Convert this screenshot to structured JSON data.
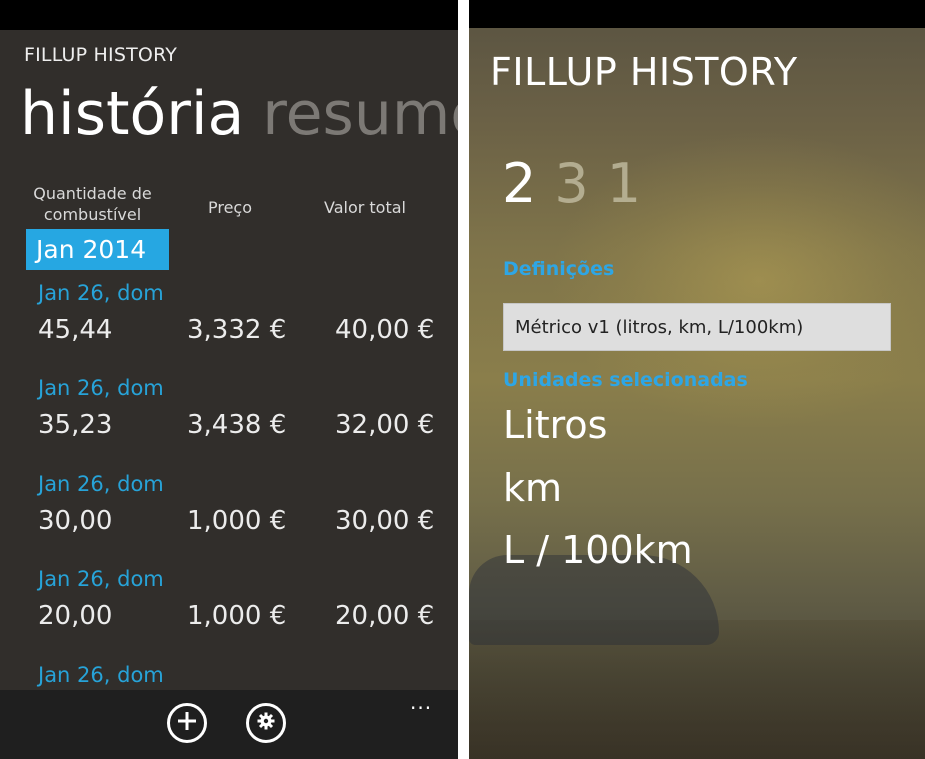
{
  "left": {
    "app_title": "FILLUP HISTORY",
    "pivot": {
      "active": "história",
      "inactive": "resumo"
    },
    "headers": {
      "quantity": "Quantidade de combustível",
      "price": "Preço",
      "total": "Valor total"
    },
    "month": "Jan 2014",
    "entries": [
      {
        "date": "Jan 26, dom",
        "quantity": "45,44",
        "price": "3,332 €",
        "total": "40,00 €"
      },
      {
        "date": "Jan 26, dom",
        "quantity": "35,23",
        "price": "3,438 €",
        "total": "32,00 €"
      },
      {
        "date": "Jan 26, dom",
        "quantity": "30,00",
        "price": "1,000 €",
        "total": "30,00 €"
      },
      {
        "date": "Jan 26, dom",
        "quantity": "20,00",
        "price": "1,000 €",
        "total": "20,00 €"
      },
      {
        "date": "Jan 26, dom"
      }
    ],
    "appbar": {
      "more": "...",
      "add_icon": "add-icon",
      "settings_icon": "gear-icon"
    }
  },
  "right": {
    "app_title": "FILLUP HISTORY",
    "pivot": {
      "active": "2",
      "inactive_1": "3",
      "inactive_2": "1"
    },
    "settings_label": "Definições",
    "units_setting": "Métrico v1 (litros, km, L/100km)",
    "selected_units_label": "Unidades selecionadas",
    "units": {
      "volume": "Litros",
      "distance": "km",
      "consumption": "L / 100km"
    }
  },
  "colors": {
    "accent": "#26a7e2",
    "left_background": "#312e2b"
  }
}
